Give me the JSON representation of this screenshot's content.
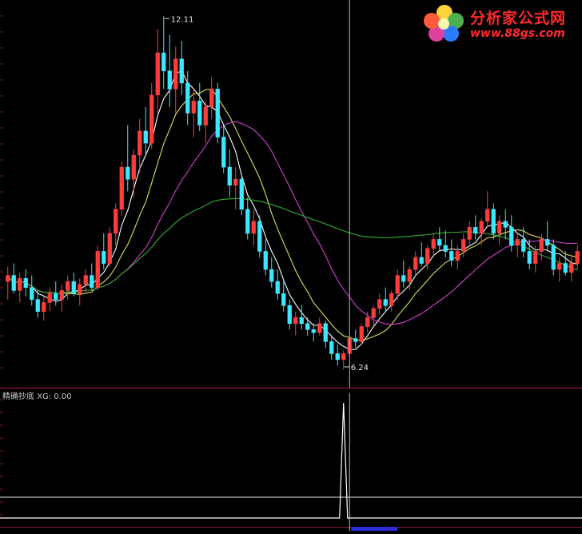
{
  "brand": {
    "name": "分析家公式网",
    "url": "www.88gs.com"
  },
  "indicator": {
    "name": "精确抄底",
    "series_label": "XG: 0.00"
  },
  "colors": {
    "up": "#ff3c3c",
    "down": "#3ce8ff",
    "ma_short": "#ffffff",
    "ma_mid": "#e0e050",
    "ma_long": "#d040d0",
    "ma_longest": "#30b030",
    "divider": "#8a1a3a",
    "cursor": "#bdbdbd",
    "signal": "#ffffff"
  },
  "chart_data": [
    {
      "type": "candlestick",
      "title": "",
      "annotations": [
        {
          "text": "12.11",
          "kind": "high"
        },
        {
          "text": "6.24",
          "kind": "low"
        }
      ],
      "price_range": [
        6.0,
        12.3
      ],
      "candles": [
        [
          7.7,
          7.95,
          7.4,
          7.8
        ],
        [
          7.8,
          8.0,
          7.5,
          7.55
        ],
        [
          7.55,
          7.85,
          7.35,
          7.75
        ],
        [
          7.75,
          7.9,
          7.45,
          7.6
        ],
        [
          7.6,
          7.8,
          7.3,
          7.4
        ],
        [
          7.4,
          7.55,
          7.1,
          7.2
        ],
        [
          7.2,
          7.45,
          7.05,
          7.35
        ],
        [
          7.35,
          7.6,
          7.2,
          7.5
        ],
        [
          7.5,
          7.7,
          7.3,
          7.4
        ],
        [
          7.4,
          7.65,
          7.2,
          7.55
        ],
        [
          7.55,
          7.8,
          7.4,
          7.7
        ],
        [
          7.7,
          7.85,
          7.45,
          7.5
        ],
        [
          7.5,
          7.75,
          7.3,
          7.65
        ],
        [
          7.65,
          7.9,
          7.5,
          7.8
        ],
        [
          7.8,
          8.0,
          7.55,
          7.6
        ],
        [
          7.6,
          8.3,
          7.55,
          8.2
        ],
        [
          8.2,
          8.5,
          7.9,
          8.0
        ],
        [
          8.0,
          8.6,
          7.95,
          8.5
        ],
        [
          8.5,
          9.0,
          8.3,
          8.9
        ],
        [
          8.9,
          9.7,
          8.8,
          9.6
        ],
        [
          9.6,
          10.3,
          9.2,
          9.4
        ],
        [
          9.4,
          9.9,
          9.1,
          9.8
        ],
        [
          9.8,
          10.4,
          9.5,
          10.2
        ],
        [
          10.2,
          10.6,
          9.8,
          10.0
        ],
        [
          10.0,
          11.0,
          9.9,
          10.8
        ],
        [
          10.8,
          11.9,
          10.5,
          11.5
        ],
        [
          11.5,
          12.11,
          10.9,
          11.2
        ],
        [
          11.2,
          11.8,
          10.6,
          10.9
        ],
        [
          10.9,
          11.6,
          10.5,
          11.4
        ],
        [
          11.4,
          11.7,
          10.8,
          11.0
        ],
        [
          11.0,
          11.2,
          10.3,
          10.5
        ],
        [
          10.5,
          10.9,
          10.1,
          10.7
        ],
        [
          10.7,
          11.0,
          10.2,
          10.3
        ],
        [
          10.3,
          10.7,
          10.0,
          10.6
        ],
        [
          10.6,
          11.1,
          10.4,
          10.9
        ],
        [
          10.9,
          11.0,
          10.0,
          10.1
        ],
        [
          10.1,
          10.3,
          9.5,
          9.6
        ],
        [
          9.6,
          9.9,
          9.1,
          9.3
        ],
        [
          9.3,
          9.6,
          8.9,
          9.4
        ],
        [
          9.4,
          9.5,
          8.8,
          8.9
        ],
        [
          8.9,
          9.1,
          8.4,
          8.5
        ],
        [
          8.5,
          8.9,
          8.3,
          8.7
        ],
        [
          8.7,
          8.8,
          8.1,
          8.2
        ],
        [
          8.2,
          8.4,
          7.8,
          7.9
        ],
        [
          7.9,
          8.1,
          7.6,
          7.7
        ],
        [
          7.7,
          7.9,
          7.4,
          7.5
        ],
        [
          7.5,
          7.7,
          7.2,
          7.3
        ],
        [
          7.3,
          7.4,
          6.9,
          7.0
        ],
        [
          7.0,
          7.2,
          6.8,
          7.1
        ],
        [
          7.1,
          7.3,
          6.9,
          7.0
        ],
        [
          7.0,
          7.1,
          6.8,
          6.9
        ],
        [
          6.9,
          7.0,
          6.7,
          6.85
        ],
        [
          6.85,
          7.1,
          6.8,
          7.0
        ],
        [
          7.0,
          7.05,
          6.6,
          6.7
        ],
        [
          6.7,
          6.8,
          6.4,
          6.5
        ],
        [
          6.5,
          6.65,
          6.3,
          6.4
        ],
        [
          6.4,
          6.55,
          6.24,
          6.5
        ],
        [
          6.5,
          6.8,
          6.45,
          6.75
        ],
        [
          6.75,
          6.9,
          6.6,
          6.7
        ],
        [
          6.7,
          7.0,
          6.65,
          6.95
        ],
        [
          6.95,
          7.2,
          6.85,
          7.1
        ],
        [
          7.1,
          7.3,
          6.95,
          7.25
        ],
        [
          7.25,
          7.5,
          7.15,
          7.4
        ],
        [
          7.4,
          7.6,
          7.2,
          7.3
        ],
        [
          7.3,
          7.55,
          7.2,
          7.5
        ],
        [
          7.5,
          7.9,
          7.4,
          7.8
        ],
        [
          7.8,
          8.05,
          7.6,
          7.7
        ],
        [
          7.7,
          7.95,
          7.55,
          7.9
        ],
        [
          7.9,
          8.2,
          7.8,
          8.1
        ],
        [
          8.1,
          8.35,
          7.95,
          8.0
        ],
        [
          8.0,
          8.3,
          7.9,
          8.25
        ],
        [
          8.25,
          8.5,
          8.1,
          8.4
        ],
        [
          8.4,
          8.6,
          8.2,
          8.3
        ],
        [
          8.3,
          8.55,
          8.1,
          8.2
        ],
        [
          8.2,
          8.4,
          7.95,
          8.05
        ],
        [
          8.05,
          8.3,
          7.9,
          8.2
        ],
        [
          8.2,
          8.5,
          8.1,
          8.4
        ],
        [
          8.4,
          8.7,
          8.3,
          8.6
        ],
        [
          8.6,
          8.8,
          8.4,
          8.5
        ],
        [
          8.5,
          8.75,
          8.3,
          8.7
        ],
        [
          8.7,
          9.2,
          8.6,
          8.9
        ],
        [
          8.9,
          9.0,
          8.4,
          8.5
        ],
        [
          8.5,
          8.8,
          8.3,
          8.7
        ],
        [
          8.7,
          8.9,
          8.4,
          8.6
        ],
        [
          8.6,
          8.8,
          8.2,
          8.3
        ],
        [
          8.3,
          8.5,
          8.1,
          8.4
        ],
        [
          8.4,
          8.6,
          8.1,
          8.2
        ],
        [
          8.2,
          8.4,
          7.9,
          8.0
        ],
        [
          8.0,
          8.3,
          7.85,
          8.2
        ],
        [
          8.2,
          8.5,
          8.05,
          8.4
        ],
        [
          8.4,
          8.7,
          8.2,
          8.3
        ],
        [
          8.3,
          8.4,
          7.8,
          7.9
        ],
        [
          7.9,
          8.1,
          7.7,
          8.0
        ],
        [
          8.0,
          8.2,
          7.8,
          7.85
        ],
        [
          7.85,
          8.1,
          7.7,
          8.0
        ],
        [
          8.0,
          8.3,
          7.9,
          8.2
        ]
      ],
      "moving_averages": [
        {
          "period": 5,
          "color_key": "ma_short"
        },
        {
          "period": 10,
          "color_key": "ma_mid"
        },
        {
          "period": 20,
          "color_key": "ma_long"
        },
        {
          "period": 60,
          "color_key": "ma_longest"
        }
      ],
      "cursor_index": 57
    },
    {
      "type": "line",
      "title": "精确抄底",
      "series": [
        {
          "name": "XG",
          "signal_index": 56,
          "values": "0 everywhere except 1 at signal_index"
        }
      ],
      "ylim": [
        0,
        1
      ]
    }
  ]
}
